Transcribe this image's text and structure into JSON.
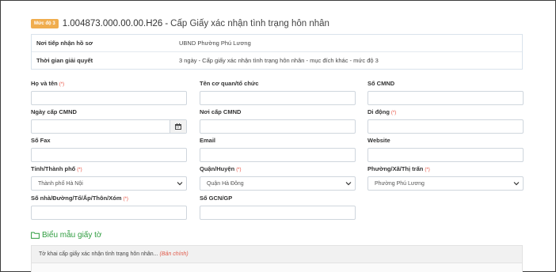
{
  "header": {
    "level_badge": "Mức độ 3",
    "code": "1.004873.000.00.00.H26",
    "separator": "-",
    "title": "Cấp Giấy xác nhận tình trạng hôn nhân"
  },
  "info": [
    {
      "label": "Nơi tiếp nhận hồ sơ",
      "value": "UBND Phường Phú Lương"
    },
    {
      "label": "Thời gian giải quyết",
      "value": "3 ngày - Cấp giấy xác nhận tình trạng hôn nhân - mục đích khác - mức độ 3"
    }
  ],
  "form": {
    "required_mark": "(*)",
    "fields": {
      "ho_ten": {
        "label": "Họ và tên",
        "required": true,
        "value": ""
      },
      "co_quan": {
        "label": "Tên cơ quan/tổ chức",
        "required": false,
        "value": ""
      },
      "so_cmnd": {
        "label": "Số CMND",
        "required": false,
        "value": ""
      },
      "ngay_cap": {
        "label": "Ngày cấp CMND",
        "required": false,
        "value": ""
      },
      "noi_cap": {
        "label": "Nơi cấp CMND",
        "required": false,
        "value": ""
      },
      "di_dong": {
        "label": "Di động",
        "required": true,
        "value": ""
      },
      "so_fax": {
        "label": "Số Fax",
        "required": false,
        "value": ""
      },
      "email": {
        "label": "Email",
        "required": false,
        "value": ""
      },
      "website": {
        "label": "Website",
        "required": false,
        "value": ""
      },
      "tinh": {
        "label": "Tỉnh/Thành phố",
        "required": true,
        "value": "Thành phố Hà Nội"
      },
      "quan": {
        "label": "Quận/Huyện",
        "required": true,
        "value": "Quận Hà Đông"
      },
      "phuong": {
        "label": "Phường/Xã/Thị trấn",
        "required": true,
        "value": "Phường Phú Lương"
      },
      "so_nha": {
        "label": "Số nhà/Đường/Tổ/Ấp/Thôn/Xóm",
        "required": true,
        "value": ""
      },
      "so_gcn": {
        "label": "Số GCN/GP",
        "required": false,
        "value": ""
      }
    }
  },
  "section": {
    "icon": "folder-icon",
    "title": "Biểu mẫu giấy tờ"
  },
  "documents": [
    {
      "name": "Tờ khai cấp giấy xác nhận tình trạng hôn nhân...",
      "type": "(Bản chính)"
    }
  ],
  "colors": {
    "badge": "#f0ad4e",
    "required": "#e74c3c",
    "section_title": "#2e9c3f",
    "doc_type": "#e05a4a"
  }
}
